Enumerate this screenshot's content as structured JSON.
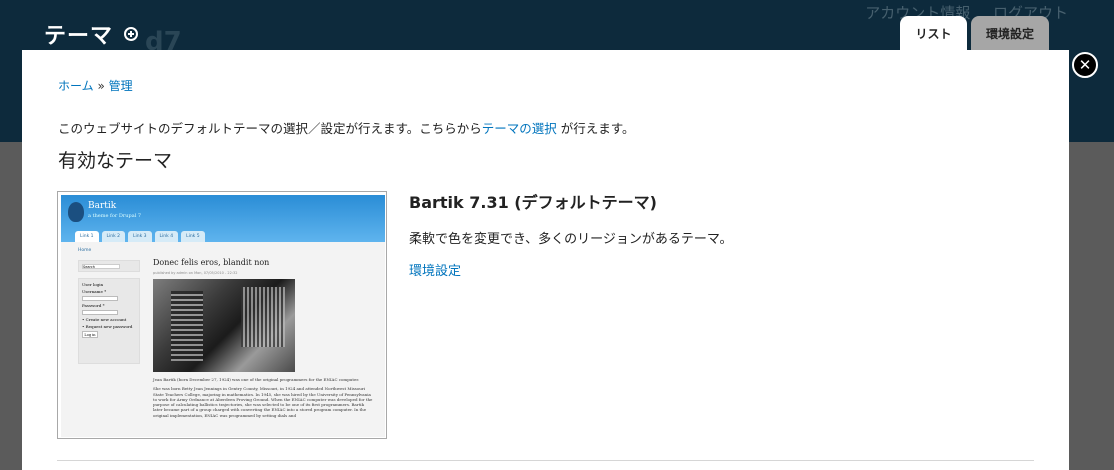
{
  "background": {
    "logo_text": "d7",
    "top_links": [
      "アカウント情報",
      "ログアウト"
    ]
  },
  "overlay": {
    "title": "テーマ",
    "tabs": [
      {
        "label": "リスト",
        "active": true
      },
      {
        "label": "環境設定",
        "active": false
      }
    ],
    "close_icon": "close-icon"
  },
  "breadcrumb": {
    "home": "ホーム",
    "separator": "»",
    "admin": "管理"
  },
  "help": {
    "before": "このウェブサイトのデフォルトテーマの選択／設定が行えます。こちらから",
    "link": "テーマの選択",
    "after": " が行えます。"
  },
  "section_title": "有効なテーマ",
  "screenshot": {
    "site_name": "Bartik",
    "slogan": "a theme for Drupal 7",
    "menu": [
      "Link 1",
      "Link 2",
      "Link 3",
      "Link 4",
      "Link 5"
    ],
    "home": "Home",
    "search": "Search",
    "login_title": "User login",
    "username": "Username *",
    "password": "Password *",
    "create_account": "• Create new account",
    "request_password": "• Request new password",
    "login_btn": "Log in",
    "node_title": "Donec felis eros, blandit non",
    "meta": "published by admin on Mon, 07/05/2010 - 22:32",
    "p1": "Jean Bartik (born December 27, 1924) was one of the original programmers for the ENIAC computer.",
    "p2": "She was born Betty Jean Jennings in Gentry County, Missouri, in 1924 and attended Northwest Missouri State Teachers College, majoring in mathematics. In 1945, she was hired by the University of Pennsylvania to work for Army Ordnance at Aberdeen Proving Ground. When the ENIAC computer was developed for the purpose of calculating ballistics trajectories, she was selected to be one of its first programmers. Bartik later became part of a group charged with converting the ENIAC into a stored program computer. In the original implementation, ENIAC was programmed by setting dials and"
  },
  "theme": {
    "name": "Bartik 7.31 (デフォルトテーマ)",
    "description": "柔軟で色を変更でき、多くのリージョンがあるテーマ。",
    "settings_link": "環境設定"
  },
  "colors": {
    "link": "#0074bd",
    "header_bg": "#0d2a3c"
  }
}
